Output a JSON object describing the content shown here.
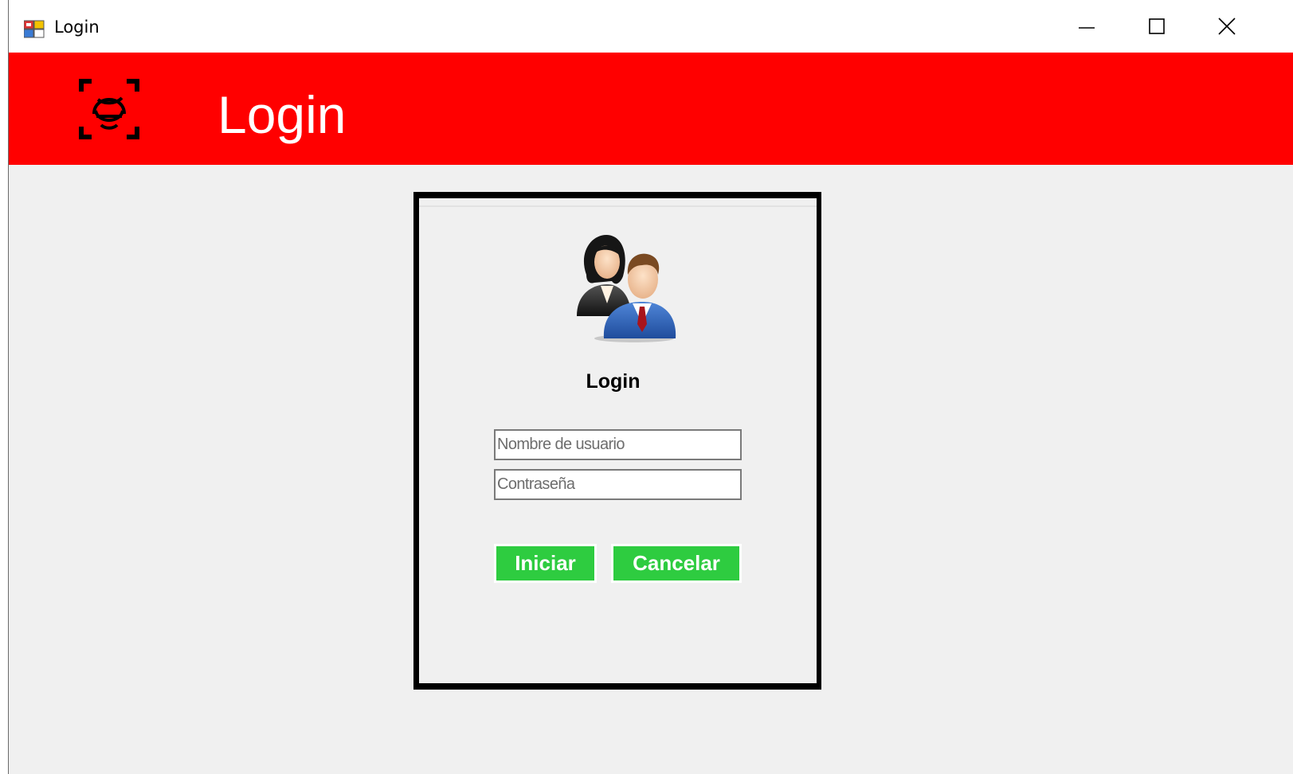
{
  "window": {
    "title": "Login",
    "controls": [
      "minimize-icon",
      "maximize-icon",
      "close-icon"
    ]
  },
  "banner": {
    "title": "Login",
    "background_color": "#ff0000",
    "icon": "face-scan-icon"
  },
  "login_panel": {
    "icon": "users-icon",
    "heading": "Login",
    "username_placeholder": "Nombre de usuario",
    "password_placeholder": "Contraseña",
    "start_button_label": "Iniciar",
    "cancel_button_label": "Cancelar",
    "button_color": "#2ecc40"
  }
}
